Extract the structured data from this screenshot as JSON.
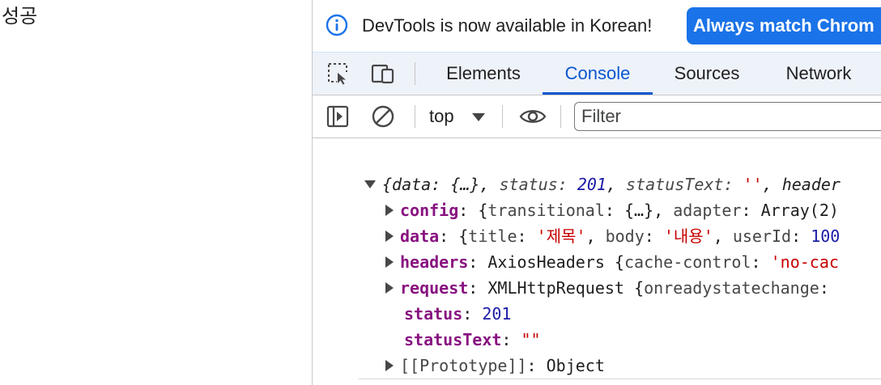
{
  "page": {
    "text": "성공"
  },
  "devtools": {
    "infobar": {
      "message": "DevTools is now available in Korean!",
      "button_label": "Always match Chrom"
    },
    "tabs": [
      {
        "label": "Elements",
        "active": false
      },
      {
        "label": "Console",
        "active": true
      },
      {
        "label": "Sources",
        "active": false
      },
      {
        "label": "Network",
        "active": false
      }
    ],
    "toolbar": {
      "context": "top",
      "filter_placeholder": "Filter"
    },
    "console": {
      "summary": {
        "p1": "{data: {…}, ",
        "status_key": "status: ",
        "status_val": "201",
        "sep": ", ",
        "statusText_key": "statusText: ",
        "statusText_val": "''",
        "rest": ", header"
      },
      "rows": [
        {
          "key": "config",
          "pre": "{",
          "parts": [
            {
              "k": "transitional",
              "v": "{…}"
            },
            {
              "k": "adapter",
              "v": "Array(2)"
            }
          ]
        },
        {
          "key": "data"
        },
        {
          "key": "headers",
          "type": "AxiosHeaders",
          "inner_key": "cache-control",
          "inner_val": "'no-cac"
        },
        {
          "key": "request",
          "type": "XMLHttpRequest",
          "inner_key": "onreadystatechange"
        }
      ],
      "data_row": {
        "title_key": "title",
        "title_val": "'제목'",
        "body_key": "body",
        "body_val": "'내용'",
        "userId_key": "userId",
        "userId_val": "100"
      },
      "status": {
        "key": "status",
        "val": "201"
      },
      "statusText": {
        "key": "statusText",
        "val": "\"\""
      },
      "prototype": {
        "key": "[[Prototype]]",
        "val": "Object"
      }
    },
    "colors": {
      "accent": "#0b57d0",
      "button_bg": "#1a73e8",
      "prop": "#881280",
      "number": "#1a1aa6",
      "string": "#c80000"
    }
  }
}
